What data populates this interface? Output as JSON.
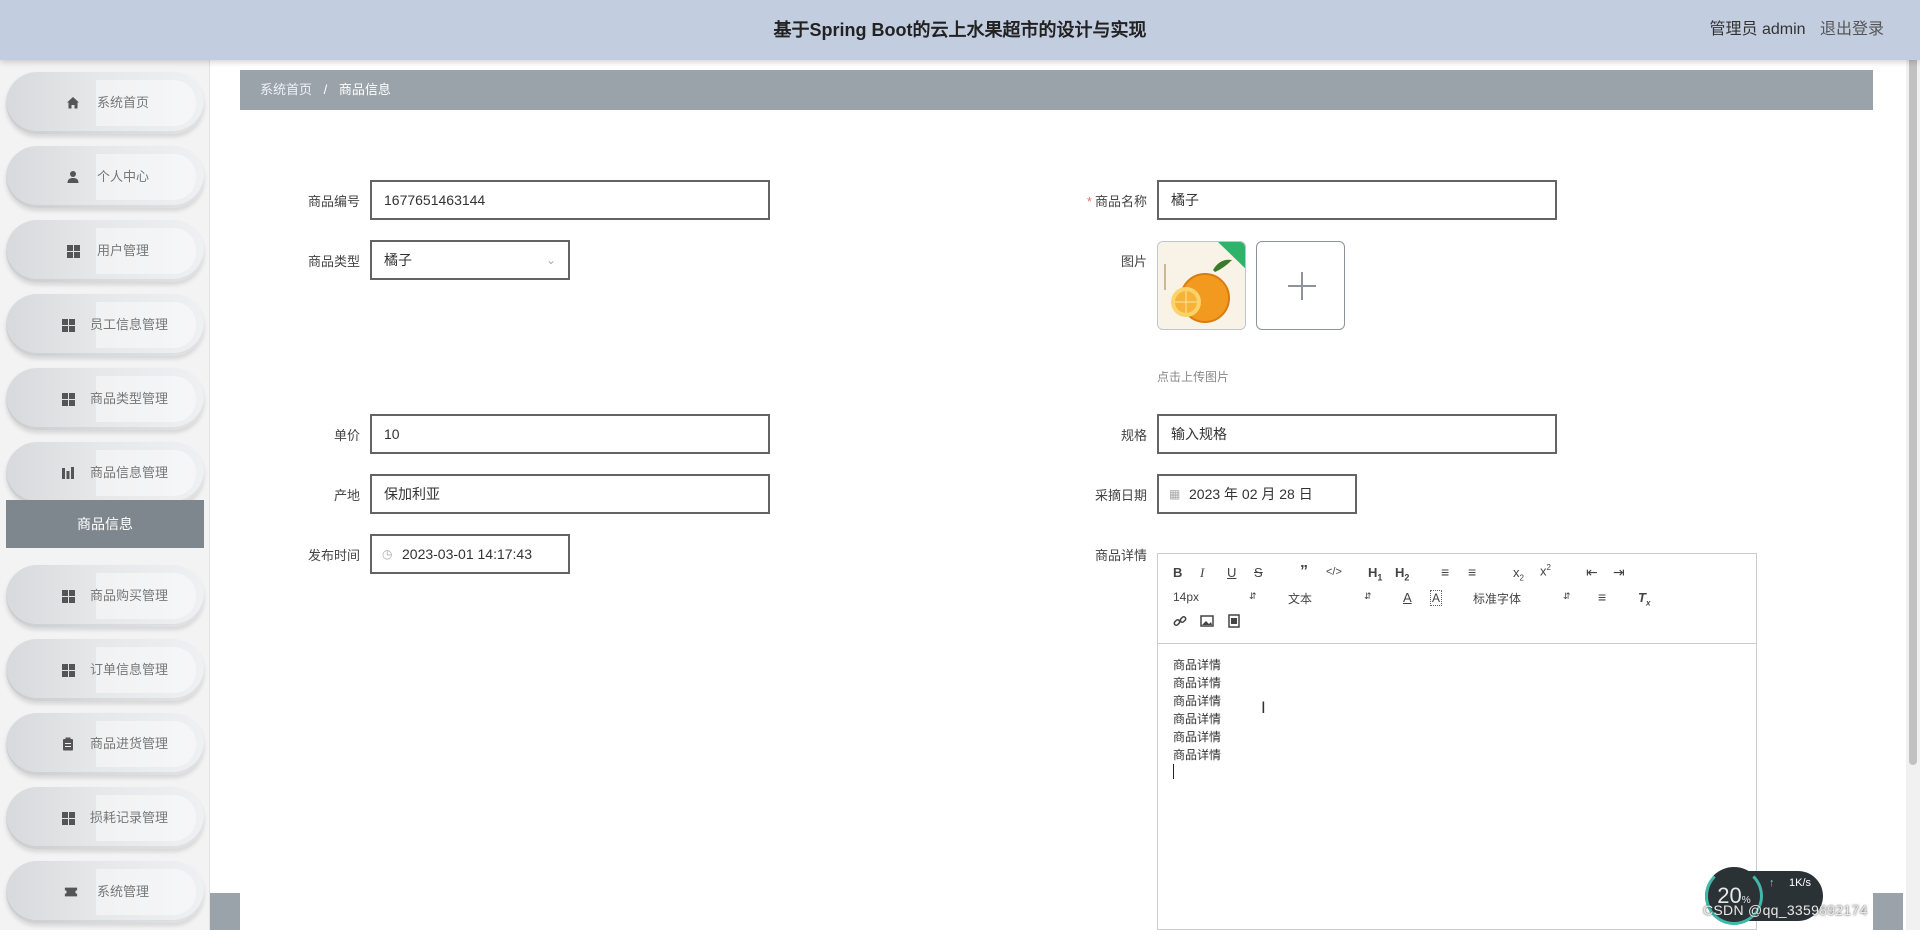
{
  "header": {
    "title": "基于Spring Boot的云上水果超市的设计与实现",
    "user_label": "管理员 admin",
    "logout_label": "退出登录"
  },
  "sidebar": {
    "items": [
      {
        "label": "系统首页",
        "icon": "home-icon"
      },
      {
        "label": "个人中心",
        "icon": "user-icon"
      },
      {
        "label": "用户管理",
        "icon": "grid-icon"
      },
      {
        "label": "员工信息管理",
        "icon": "grid-icon"
      },
      {
        "label": "商品类型管理",
        "icon": "grid-icon"
      },
      {
        "label": "商品信息管理",
        "icon": "chart-icon"
      },
      {
        "label": "商品购买管理",
        "icon": "grid-icon"
      },
      {
        "label": "订单信息管理",
        "icon": "grid-icon"
      },
      {
        "label": "商品进货管理",
        "icon": "clipboard-icon"
      },
      {
        "label": "损耗记录管理",
        "icon": "grid-icon"
      },
      {
        "label": "系统管理",
        "icon": "ticket-icon"
      }
    ],
    "sub_item": "商品信息"
  },
  "breadcrumb": {
    "home": "系统首页",
    "separator": "/",
    "current": "商品信息"
  },
  "form": {
    "code_label": "商品编号",
    "code_value": "1677651463144",
    "name_label": "商品名称",
    "name_value": "橘子",
    "type_label": "商品类型",
    "type_value": "橘子",
    "image_label": "图片",
    "upload_tip": "点击上传图片",
    "price_label": "单价",
    "price_value": "10",
    "spec_label": "规格",
    "spec_placeholder": "输入规格",
    "origin_label": "产地",
    "origin_value": "保加利亚",
    "pick_date_label": "采摘日期",
    "pick_date_value": "2023 年 02 月 28 日",
    "publish_time_label": "发布时间",
    "publish_time_value": "2023-03-01 14:17:43",
    "detail_label": "商品详情"
  },
  "editor": {
    "font_size": "14px",
    "text_format": "文本",
    "font_family": "标准字体",
    "content_lines": [
      "商品详情",
      "商品详情",
      "商品详情",
      "商品详情",
      "商品详情",
      "商品详情"
    ]
  },
  "overlay": {
    "speed_value": "20",
    "speed_unit": "%",
    "net_up": "1K/s",
    "watermark": "CSDN @qq_3359892174"
  },
  "colors": {
    "header_bg": "#c3cde0",
    "breadcrumb_bg": "#9aa3aa",
    "sub_item_bg": "#7d878d",
    "required": "#f56c6c"
  }
}
